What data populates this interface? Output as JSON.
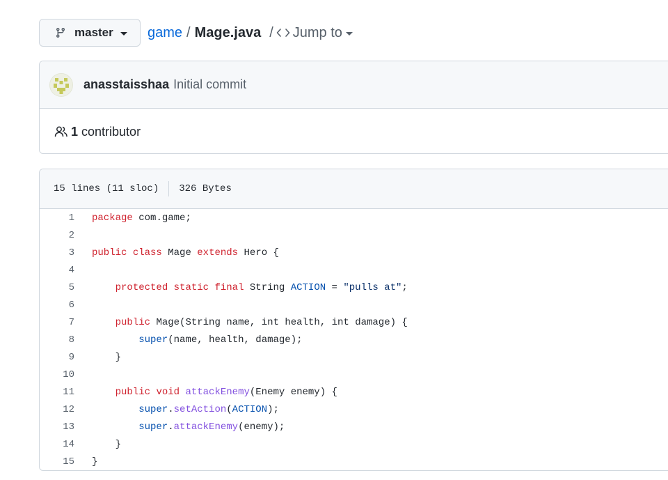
{
  "branch": {
    "name": "master",
    "icon": "git-branch-icon"
  },
  "breadcrumb": {
    "repo": "game",
    "separator": "/",
    "file": "Mage.java",
    "jump_separator": "/",
    "jump_label": "Jump to",
    "jump_icon": "code-icon"
  },
  "commit": {
    "author": "anasstaisshaa",
    "message": "Initial commit"
  },
  "contributors": {
    "count": "1",
    "label": "contributor",
    "icon": "people-icon"
  },
  "file_info": {
    "lines": "15 lines (11 sloc)",
    "size": "326 Bytes"
  },
  "code_lines": [
    {
      "num": "1",
      "tokens": [
        [
          "k",
          "package"
        ],
        [
          "",
          "com.game;"
        ]
      ]
    },
    {
      "num": "2",
      "tokens": []
    },
    {
      "num": "3",
      "tokens": [
        [
          "k",
          "public"
        ],
        [
          "",
          ""
        ],
        [
          "k",
          "class"
        ],
        [
          "",
          "Mage"
        ],
        [
          "k",
          "extends"
        ],
        [
          "",
          "Hero {"
        ]
      ]
    },
    {
      "num": "4",
      "tokens": []
    },
    {
      "num": "5",
      "tokens": [
        [
          "",
          "    "
        ],
        [
          "k",
          "protected"
        ],
        [
          "k",
          "static"
        ],
        [
          "k",
          "final"
        ],
        [
          "",
          "String"
        ],
        [
          "e",
          "ACTION"
        ],
        [
          "",
          "="
        ],
        [
          "s",
          "\"pulls at\""
        ],
        [
          "",
          ";"
        ]
      ]
    },
    {
      "num": "6",
      "tokens": []
    },
    {
      "num": "7",
      "tokens": [
        [
          "",
          "    "
        ],
        [
          "k",
          "public"
        ],
        [
          "",
          "Mage(String name, int health, int damage) {"
        ]
      ]
    },
    {
      "num": "8",
      "tokens": [
        [
          "",
          "        "
        ],
        [
          "e",
          "super"
        ],
        [
          "",
          "(name, health, damage);"
        ]
      ]
    },
    {
      "num": "9",
      "tokens": [
        [
          "",
          "    }"
        ]
      ]
    },
    {
      "num": "10",
      "tokens": []
    },
    {
      "num": "11",
      "tokens": [
        [
          "",
          "    "
        ],
        [
          "k",
          "public"
        ],
        [
          "",
          "void"
        ],
        [
          "f",
          "attackEnemy"
        ],
        [
          "",
          "(Enemy enemy) {"
        ]
      ]
    },
    {
      "num": "12",
      "tokens": [
        [
          "",
          "        "
        ],
        [
          "e",
          "super"
        ],
        [
          "",
          "."
        ],
        [
          "f",
          "setAction"
        ],
        [
          "",
          "("
        ],
        [
          "e",
          "ACTION"
        ],
        [
          "",
          ");"
        ]
      ]
    },
    {
      "num": "13",
      "tokens": [
        [
          "",
          "        "
        ],
        [
          "e",
          "super"
        ],
        [
          "",
          "."
        ],
        [
          "f",
          "attackEnemy"
        ],
        [
          "",
          "(enemy);"
        ]
      ]
    },
    {
      "num": "14",
      "tokens": [
        [
          "",
          "    }"
        ]
      ]
    },
    {
      "num": "15",
      "tokens": [
        [
          "",
          "}"
        ]
      ]
    }
  ],
  "code_text": [
    "package com.game;",
    "",
    "public class Mage extends Hero {",
    "",
    "    protected static final String ACTION = \"pulls at\";",
    "",
    "    public Mage(String name, int health, int damage) {",
    "        super(name, health, damage);",
    "    }",
    "",
    "    public void attackEnemy(Enemy enemy) {",
    "        super.setAction(ACTION);",
    "        super.attackEnemy(enemy);",
    "    }",
    "}"
  ],
  "colors": {
    "keyword": "#cf222e",
    "constant": "#0550ae",
    "function": "#8250df",
    "string": "#0a3069",
    "link": "#0969da"
  }
}
